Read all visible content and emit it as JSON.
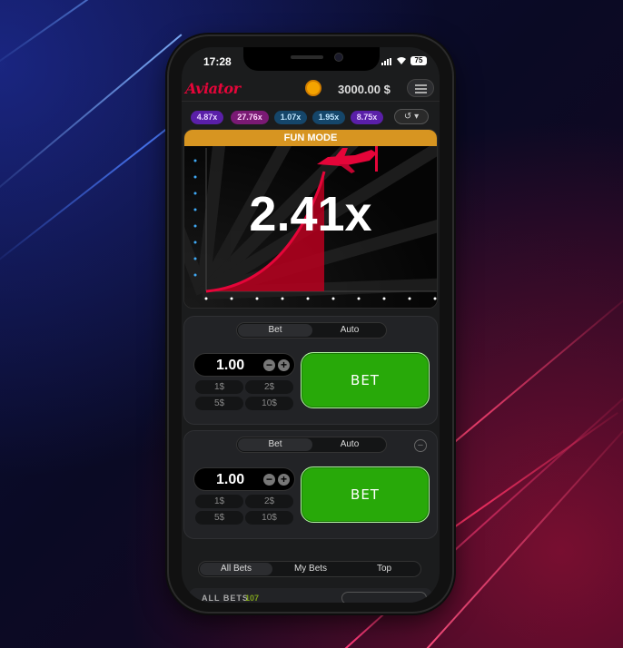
{
  "status_bar": {
    "time": "17:28",
    "battery": "75"
  },
  "header": {
    "logo": "Aviator",
    "balance": "3000.00 $"
  },
  "multiplier_history": [
    {
      "value": "4.87x",
      "color": "#913ef8"
    },
    {
      "value": "27.76x",
      "color": "#c017b4"
    },
    {
      "value": "1.07x",
      "color": "#34b4ff"
    },
    {
      "value": "1.95x",
      "color": "#34b4ff"
    },
    {
      "value": "8.75x",
      "color": "#913ef8"
    }
  ],
  "game": {
    "banner": "FUN MODE",
    "current_multiplier": "2.41x"
  },
  "bet_panels": [
    {
      "tabs": [
        "Bet",
        "Auto"
      ],
      "amount": "1.00",
      "quick_amounts": [
        "1$",
        "2$",
        "5$",
        "10$"
      ],
      "bet_label": "BET"
    },
    {
      "tabs": [
        "Bet",
        "Auto"
      ],
      "amount": "1.00",
      "quick_amounts": [
        "1$",
        "2$",
        "5$",
        "10$"
      ],
      "bet_label": "BET"
    }
  ],
  "bottom_tabs": [
    "All Bets",
    "My Bets",
    "Top"
  ],
  "all_bets": {
    "label": "ALL BETS",
    "count": "107"
  }
}
